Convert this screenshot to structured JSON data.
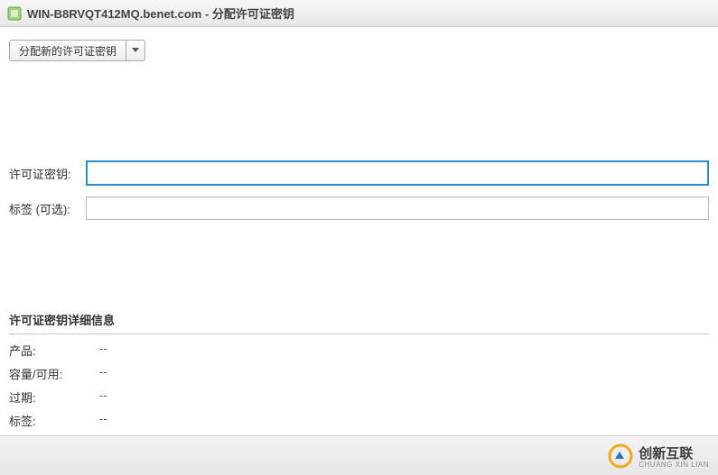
{
  "titlebar": {
    "host": "WIN-B8RVQT412MQ.benet.com",
    "separator": " - ",
    "title": "分配许可证密钥"
  },
  "toolbar": {
    "assign_new_key_label": "分配新的许可证密钥"
  },
  "form": {
    "license_key_label": "许可证密钥:",
    "license_key_value": "",
    "tag_optional_label": "标签 (可选):",
    "tag_optional_value": ""
  },
  "details": {
    "header": "许可证密钥详细信息",
    "rows": [
      {
        "label": "产品:",
        "value": "--"
      },
      {
        "label": "容量/可用:",
        "value": "--"
      },
      {
        "label": "过期:",
        "value": "--"
      },
      {
        "label": "标签:",
        "value": "--"
      }
    ]
  },
  "brand": {
    "name": "创新互联",
    "sub": "CHUANG XIN LIAN"
  }
}
